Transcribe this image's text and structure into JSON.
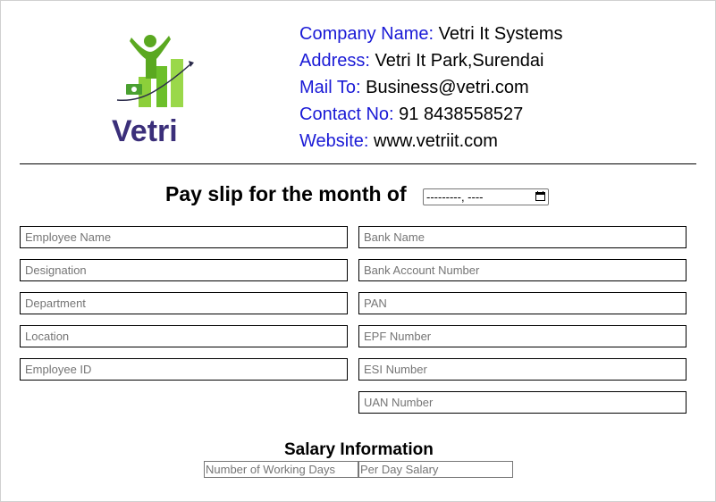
{
  "company": {
    "logo_text": "Vetri",
    "name_label": "Company Name:",
    "name_value": "Vetri It Systems",
    "address_label": "Address:",
    "address_value": "Vetri It Park,Surendai",
    "mail_label": "Mail To:",
    "mail_value": "Business@vetri.com",
    "contact_label": "Contact No:",
    "contact_value": "91 8438558527",
    "website_label": "Website:",
    "website_value": "www.vetriit.com"
  },
  "payslip": {
    "title": "Pay slip for the month of",
    "month_value": "---------, ----"
  },
  "fields_left": [
    "Employee Name",
    "Designation",
    "Department",
    "Location",
    "Employee ID"
  ],
  "fields_right": [
    "Bank Name",
    "Bank Account Number",
    "PAN",
    "EPF Number",
    "ESI Number",
    "UAN Number"
  ],
  "salary": {
    "title": "Salary Information",
    "working_days_placeholder": "Number of Working Days",
    "per_day_placeholder": "Per Day Salary"
  },
  "colors": {
    "label_blue": "#1a1ad6",
    "logo_purple": "#3b2f7a",
    "logo_green": "#6cbf2a"
  }
}
